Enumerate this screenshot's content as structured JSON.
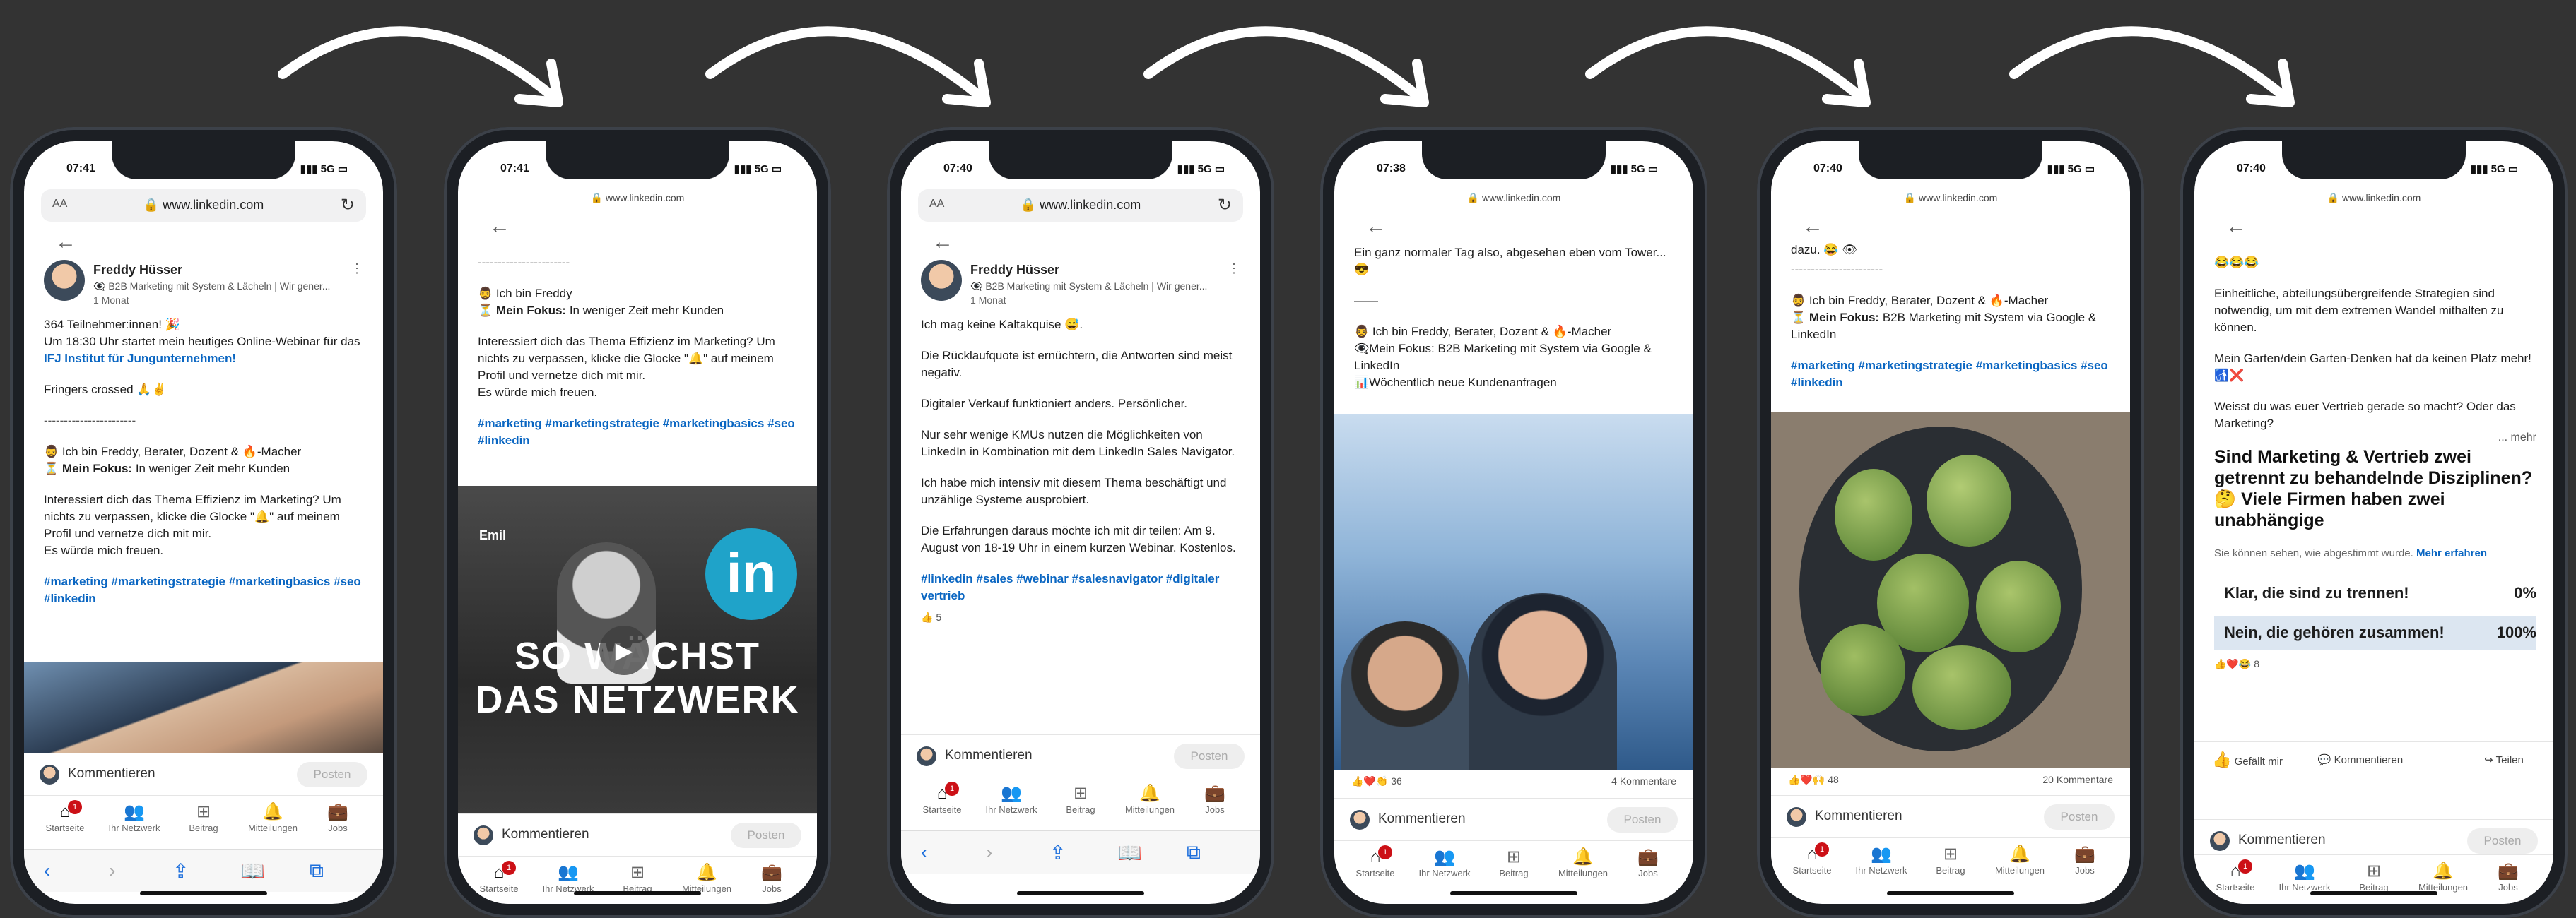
{
  "colors": {
    "background": "#333333",
    "accent": "#0a66c2",
    "badge": "#cc1016"
  },
  "phones": [
    {
      "time": "07:41",
      "signal": "5G",
      "url": "www.linkedin.com",
      "author": {
        "name": "Freddy Hüsser",
        "subtitle": "👁‍🗨 B2B Marketing mit System & Lächeln | Wir gener...",
        "time": "1 Monat"
      },
      "lines": {
        "l1": "364 Teilnehmer:innen! 🎉",
        "l2": "Um 18:30 Uhr startet mein heutiges Online-Webinar für das",
        "l2link": "IFJ Institut für Jungunternehmen!",
        "l3": "Fringers crossed 🙏✌",
        "sep": "-----------------------",
        "l4": "🧔‍♂️ Ich bin Freddy, Berater, Dozent & 🔥-Macher",
        "l5label": "Mein Fokus:",
        "l5": "In weniger Zeit mehr Kunden",
        "l6": "Interessiert dich das Thema Effizienz im Marketing? Um nichts zu verpassen, klicke die Glocke \"🔔\" auf meinem Profil und vernetze dich mit mir.",
        "l7": "Es würde mich freuen.",
        "tags": "#marketing #marketingstrategie #marketingbasics #seo #linkedin"
      }
    },
    {
      "time": "07:41",
      "signal": "5G",
      "url": "www.linkedin.com",
      "lines": {
        "sep": "-----------------------",
        "l1": "🧔‍♂️ Ich bin Freddy",
        "l2label": "Mein Fokus:",
        "l2": "In weniger Zeit mehr Kunden",
        "l3": "Interessiert dich das Thema Effizienz im Marketing? Um nichts zu verpassen, klicke die Glocke \"🔔\" auf meinem Profil und vernetze dich mit mir.",
        "l4": "Es würde mich freuen.",
        "tags": "#marketing #marketingstrategie #marketingbasics #seo #linkedin"
      },
      "media": {
        "name_tag": "Emil",
        "logo": "in",
        "headline1": "SO WÄCHST",
        "headline2": "DAS NETZWERK"
      }
    },
    {
      "time": "07:40",
      "signal": "5G",
      "url": "www.linkedin.com",
      "author": {
        "name": "Freddy Hüsser",
        "subtitle": "👁‍🗨 B2B Marketing mit System & Lächeln | Wir gener...",
        "time": "1 Monat"
      },
      "lines": {
        "l1": "Ich mag keine Kaltakquise 😅.",
        "l2": "Die Rücklaufquote ist ernüchtern, die Antworten sind meist negativ.",
        "l3": "Digitaler Verkauf funktioniert anders. Persönlicher.",
        "l4": "Nur sehr wenige KMUs nutzen die Möglichkeiten von LinkedIn in Kombination mit dem LinkedIn Sales Navigator.",
        "l5": "Ich habe mich intensiv mit diesem Thema beschäftigt und unzählige Systeme ausprobiert.",
        "l6": "Die Erfahrungen daraus möchte ich mit dir teilen: Am 9. August von 18-19 Uhr in einem kurzen Webinar. Kostenlos.",
        "tags": "#linkedin #sales #webinar #salesnavigator #digitaler vertrieb",
        "reactions": "5"
      }
    },
    {
      "time": "07:38",
      "signal": "5G",
      "url": "www.linkedin.com",
      "lines": {
        "l1": "Ein ganz normaler Tag also, abgesehen eben vom Tower... 😎",
        "sep": "——",
        "l2": "🧔‍♂️ Ich bin Freddy, Berater, Dozent & 🔥-Macher",
        "l3": "👁‍🗨Mein Fokus: B2B Marketing mit System via Google & LinkedIn",
        "l4": "📊Wöchentlich neue Kundenanfragen",
        "reactions": "36",
        "comments": "4 Kommentare"
      }
    },
    {
      "time": "07:40",
      "signal": "5G",
      "url": "www.linkedin.com",
      "lines": {
        "l0": "dazu. 😂 👁",
        "sep": "-----------------------",
        "l1": "🧔‍♂️ Ich bin Freddy, Berater, Dozent & 🔥-Macher",
        "l2label": "Mein Fokus:",
        "l2": "B2B Marketing mit System via Google & LinkedIn",
        "tags": "#marketing #marketingstrategie #marketingbasics #seo #linkedin",
        "reactions": "48",
        "comments": "20 Kommentare"
      }
    },
    {
      "time": "07:40",
      "signal": "5G",
      "url": "www.linkedin.com",
      "lines": {
        "l1": "😂😂😂",
        "l2": "Einheitliche, abteilungsübergreifende Strategien sind notwendig, um mit dem extremen Wandel mithalten zu können.",
        "l3": "Mein Garten/dein Garten-Denken hat da keinen Platz mehr!🚮❌",
        "l4": "Weisst du was euer Vertrieb gerade so macht? Oder das Marketing?",
        "more": "... mehr",
        "question": "Sind Marketing & Vertrieb zwei getrennt zu behandelnde Disziplinen?🤔 Viele Firmen haben zwei unabhängige",
        "note": "Sie können sehen, wie abgestimmt wurde.",
        "note_link": "Mehr erfahren",
        "reactions": "8"
      },
      "poll": [
        {
          "label": "Klar, die sind zu trennen!",
          "pct": "0%",
          "value": 0
        },
        {
          "label": "Nein, die gehören zusammen!",
          "pct": "100%",
          "value": 100
        }
      ],
      "actions": {
        "like": "Gefällt mir",
        "comment": "Kommentieren",
        "share": "Teilen"
      }
    }
  ],
  "ui": {
    "comment_placeholder": "Kommentieren",
    "post_button": "Posten",
    "aa": "AA",
    "nav": {
      "home": "Startseite",
      "network": "Ihr Netzwerk",
      "post": "Beitrag",
      "notifications": "Mitteilungen",
      "jobs": "Jobs"
    },
    "badge": "1"
  }
}
